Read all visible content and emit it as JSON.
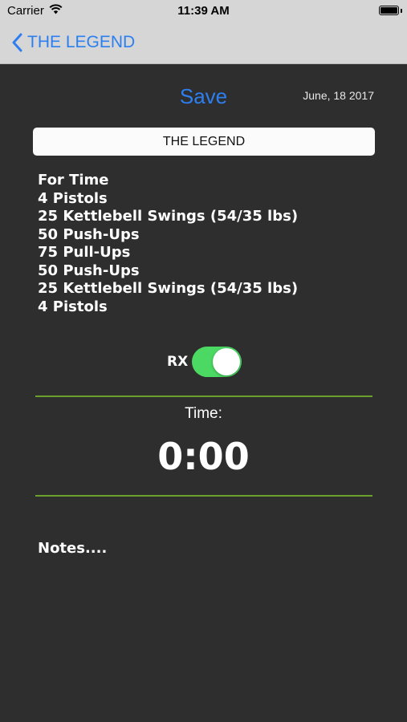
{
  "status_bar": {
    "carrier": "Carrier",
    "wifi_icon": "wifi-icon",
    "time": "11:39 AM",
    "battery_level": 1.0
  },
  "nav": {
    "back_icon": "chevron-left-icon",
    "back_label": "THE LEGEND"
  },
  "header": {
    "save_label": "Save",
    "date": "June, 18 2017"
  },
  "workout_title": "THE LEGEND",
  "workout_lines": [
    "For Time",
    "4 Pistols",
    "25 Kettlebell Swings (54/35 lbs)",
    "50 Push-Ups",
    "75 Pull-Ups",
    "50 Push-Ups",
    "25 Kettlebell Swings (54/35 lbs)",
    "4 Pistols"
  ],
  "rx": {
    "label": "RX",
    "on": true
  },
  "time": {
    "label": "Time:",
    "value": "0:00"
  },
  "notes_placeholder": "Notes....",
  "colors": {
    "accent_blue": "#2d7ff0",
    "toggle_green": "#4cd963",
    "divider_green": "#6aa02b",
    "background": "#2e2e2e",
    "bar_gray": "#d6d6d6"
  }
}
